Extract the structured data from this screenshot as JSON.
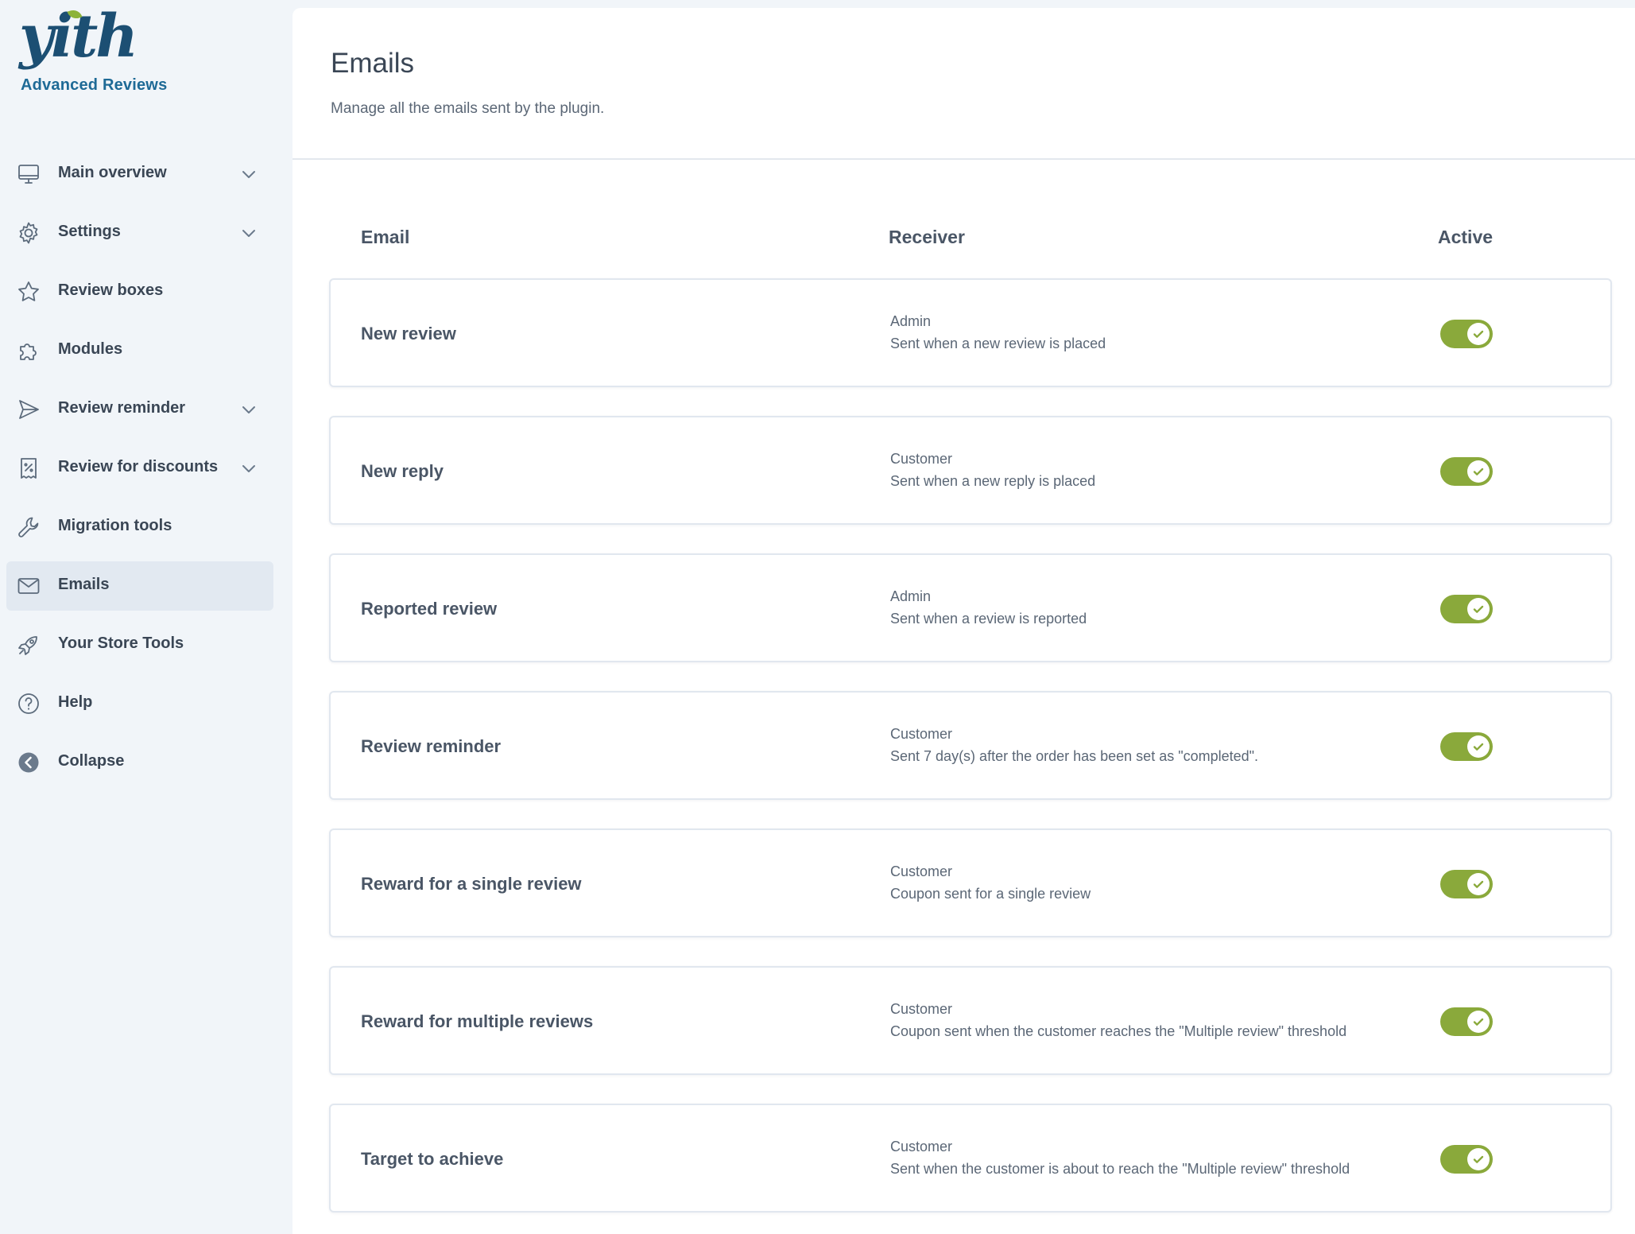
{
  "brand": {
    "logo_text": "yith",
    "product_name": "Advanced Reviews"
  },
  "nav": {
    "items": [
      {
        "label": "Main overview",
        "icon": "monitor-icon",
        "has_submenu": true,
        "active": false
      },
      {
        "label": "Settings",
        "icon": "gear-icon",
        "has_submenu": true,
        "active": false
      },
      {
        "label": "Review boxes",
        "icon": "star-icon",
        "has_submenu": false,
        "active": false
      },
      {
        "label": "Modules",
        "icon": "puzzle-icon",
        "has_submenu": false,
        "active": false
      },
      {
        "label": "Review reminder",
        "icon": "send-icon",
        "has_submenu": true,
        "active": false
      },
      {
        "label": "Review for discounts",
        "icon": "receipt-percent-icon",
        "has_submenu": true,
        "active": false
      },
      {
        "label": "Migration tools",
        "icon": "wrench-icon",
        "has_submenu": false,
        "active": false
      },
      {
        "label": "Emails",
        "icon": "envelope-icon",
        "has_submenu": false,
        "active": true
      },
      {
        "label": "Your Store Tools",
        "icon": "rocket-icon",
        "has_submenu": false,
        "active": false
      },
      {
        "label": "Help",
        "icon": "question-circle-icon",
        "has_submenu": false,
        "active": false
      },
      {
        "label": "Collapse",
        "icon": "collapse-arrow-icon",
        "has_submenu": false,
        "active": false
      }
    ]
  },
  "page": {
    "title": "Emails",
    "description": "Manage all the emails sent by the plugin."
  },
  "table": {
    "headers": {
      "email": "Email",
      "receiver": "Receiver",
      "active": "Active"
    },
    "rows": [
      {
        "name": "New review",
        "receiver": "Admin",
        "description": "Sent when a new review is placed",
        "active": true
      },
      {
        "name": "New reply",
        "receiver": "Customer",
        "description": "Sent when a new reply is placed",
        "active": true
      },
      {
        "name": "Reported review",
        "receiver": "Admin",
        "description": "Sent when a review is reported",
        "active": true
      },
      {
        "name": "Review reminder",
        "receiver": "Customer",
        "description": "Sent 7 day(s) after the order has been set as \"completed\".",
        "active": true
      },
      {
        "name": "Reward for a single review",
        "receiver": "Customer",
        "description": "Coupon sent for a single review",
        "active": true
      },
      {
        "name": "Reward for multiple reviews",
        "receiver": "Customer",
        "description": "Coupon sent when the customer reaches the \"Multiple review\" threshold",
        "active": true
      },
      {
        "name": "Target to achieve",
        "receiver": "Customer",
        "description": "Sent when the customer is about to reach the \"Multiple review\" threshold",
        "active": true
      }
    ]
  },
  "colors": {
    "sidebar_bg": "#f1f5f9",
    "brand_blue": "#1c4f73",
    "brand_green": "#8cb33a",
    "toggle_on": "#8aa93b",
    "active_nav_bg": "#e2e9f1"
  }
}
